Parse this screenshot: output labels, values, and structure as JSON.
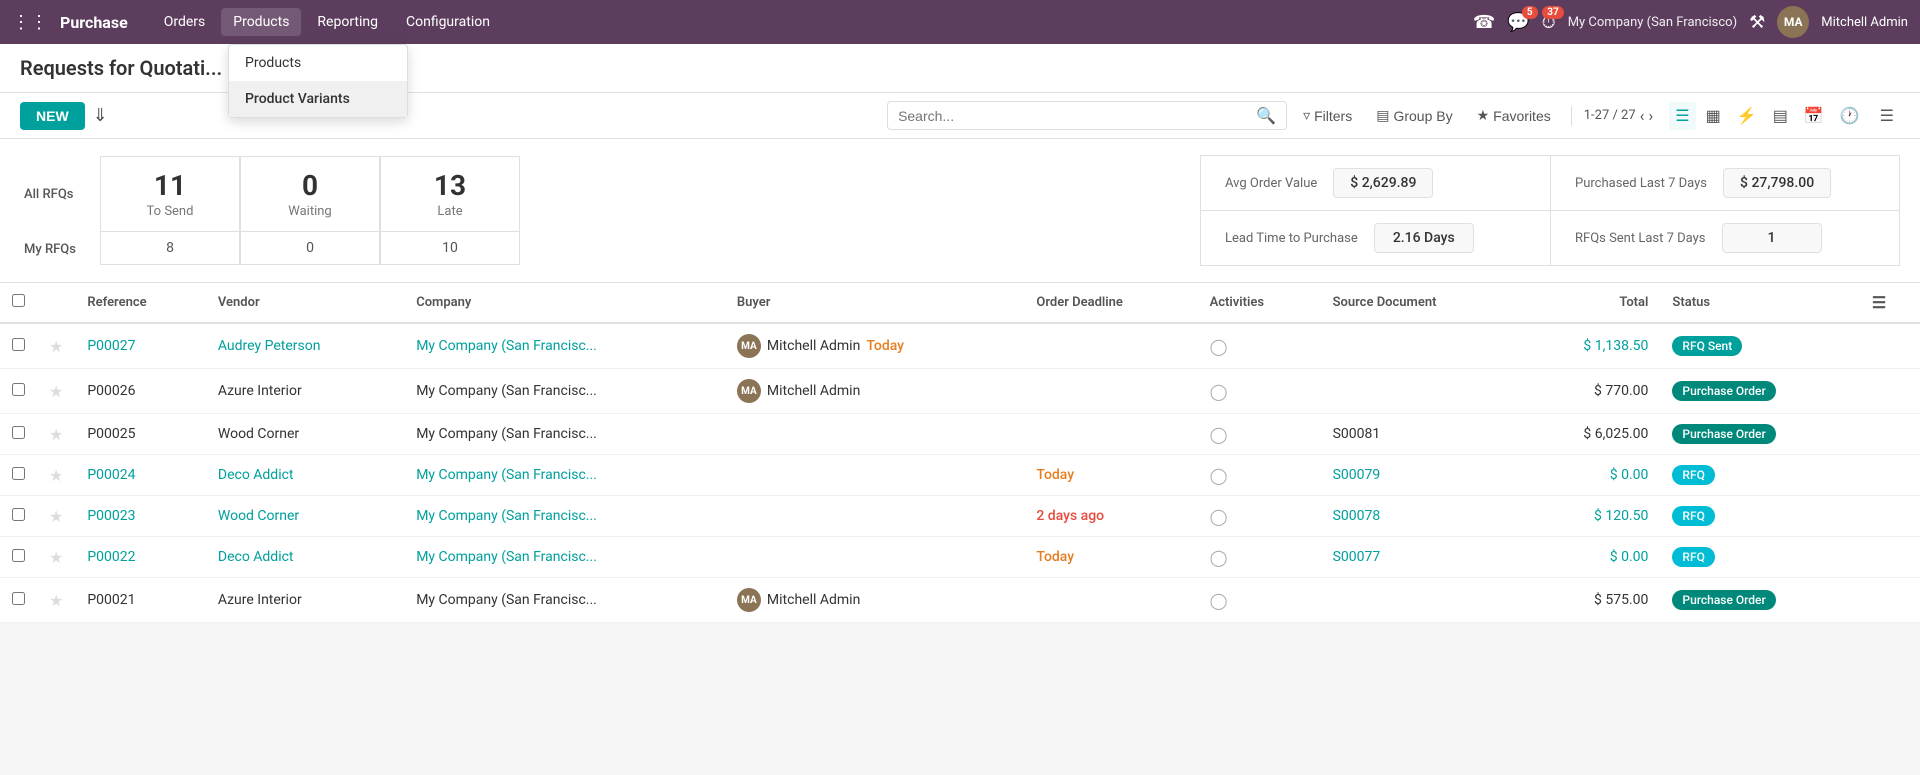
{
  "app": {
    "name": "Purchase"
  },
  "topnav": {
    "menu_items": [
      "Orders",
      "Products",
      "Reporting",
      "Configuration"
    ],
    "active_menu": "Products",
    "company": "My Company (San Francisco)",
    "username": "Mitchell Admin",
    "badges": {
      "chat": "5",
      "activity": "37"
    }
  },
  "dropdown": {
    "items": [
      {
        "label": "Products",
        "active": false
      },
      {
        "label": "Product Variants",
        "active": true
      }
    ]
  },
  "page": {
    "title": "Requests for Quotati..."
  },
  "toolbar": {
    "new_label": "NEW",
    "search_placeholder": "Search...",
    "filter_label": "Filters",
    "groupby_label": "Group By",
    "favorites_label": "Favorites",
    "pagination": "1-27 / 27"
  },
  "stats": {
    "all_rfqs_label": "All RFQs",
    "my_rfqs_label": "My RFQs",
    "cards": [
      {
        "number": "11",
        "label": "To Send",
        "active": false
      },
      {
        "number": "0",
        "label": "Waiting",
        "active": false
      },
      {
        "number": "13",
        "label": "Late",
        "active": false
      }
    ],
    "my_cards": [
      "8",
      "0",
      "10"
    ],
    "kpi": [
      {
        "label": "Avg Order Value",
        "value": "$ 2,629.89"
      },
      {
        "label": "Purchased Last 7 Days",
        "value": "$ 27,798.00"
      },
      {
        "label": "Lead Time to Purchase",
        "value": "2.16 Days"
      },
      {
        "label": "RFQs Sent Last 7 Days",
        "value": "1"
      }
    ]
  },
  "table": {
    "columns": [
      "Reference",
      "Vendor",
      "Company",
      "Buyer",
      "Order Deadline",
      "Activities",
      "Source Document",
      "Total",
      "Status"
    ],
    "rows": [
      {
        "ref": "P00027",
        "vendor": "Audrey Peterson",
        "vendor_link": true,
        "company": "My Company (San Francisc...",
        "company_link": true,
        "buyer": "Mitchell Admin",
        "buyer_has_avatar": true,
        "deadline": "Today",
        "deadline_style": "today",
        "source": "",
        "total": "$ 1,138.50",
        "total_link": true,
        "status": "RFQ Sent",
        "status_class": "status-rfq-sent"
      },
      {
        "ref": "P00026",
        "vendor": "Azure Interior",
        "vendor_link": false,
        "company": "My Company (San Francisc...",
        "company_link": false,
        "buyer": "Mitchell Admin",
        "buyer_has_avatar": true,
        "deadline": "",
        "deadline_style": "",
        "source": "",
        "total": "$ 770.00",
        "total_link": false,
        "status": "Purchase Order",
        "status_class": "status-purchase-order"
      },
      {
        "ref": "P00025",
        "vendor": "Wood Corner",
        "vendor_link": false,
        "company": "My Company (San Francisc...",
        "company_link": false,
        "buyer": "",
        "buyer_has_avatar": false,
        "deadline": "",
        "deadline_style": "",
        "source": "S00081",
        "total": "$ 6,025.00",
        "total_link": false,
        "status": "Purchase Order",
        "status_class": "status-purchase-order"
      },
      {
        "ref": "P00024",
        "vendor": "Deco Addict",
        "vendor_link": true,
        "company": "My Company (San Francisc...",
        "company_link": true,
        "buyer": "",
        "buyer_has_avatar": false,
        "deadline": "Today",
        "deadline_style": "today",
        "source": "S00079",
        "source_link": true,
        "total": "$ 0.00",
        "total_link": true,
        "status": "RFQ",
        "status_class": "status-rfq"
      },
      {
        "ref": "P00023",
        "vendor": "Wood Corner",
        "vendor_link": true,
        "company": "My Company (San Francisc...",
        "company_link": true,
        "buyer": "",
        "buyer_has_avatar": false,
        "deadline": "2 days ago",
        "deadline_style": "ago",
        "source": "S00078",
        "source_link": true,
        "total": "$ 120.50",
        "total_link": true,
        "status": "RFQ",
        "status_class": "status-rfq"
      },
      {
        "ref": "P00022",
        "vendor": "Deco Addict",
        "vendor_link": true,
        "company": "My Company (San Francisc...",
        "company_link": true,
        "buyer": "",
        "buyer_has_avatar": false,
        "deadline": "Today",
        "deadline_style": "today",
        "source": "S00077",
        "source_link": true,
        "total": "$ 0.00",
        "total_link": true,
        "status": "RFQ",
        "status_class": "status-rfq"
      },
      {
        "ref": "P00021",
        "vendor": "Azure Interior",
        "vendor_link": false,
        "company": "My Company (San Francisc...",
        "company_link": false,
        "buyer": "Mitchell Admin",
        "buyer_has_avatar": true,
        "deadline": "",
        "deadline_style": "",
        "source": "",
        "total": "$ 575.00",
        "total_link": false,
        "status": "Purchase Order",
        "status_class": "status-purchase-order"
      }
    ]
  }
}
